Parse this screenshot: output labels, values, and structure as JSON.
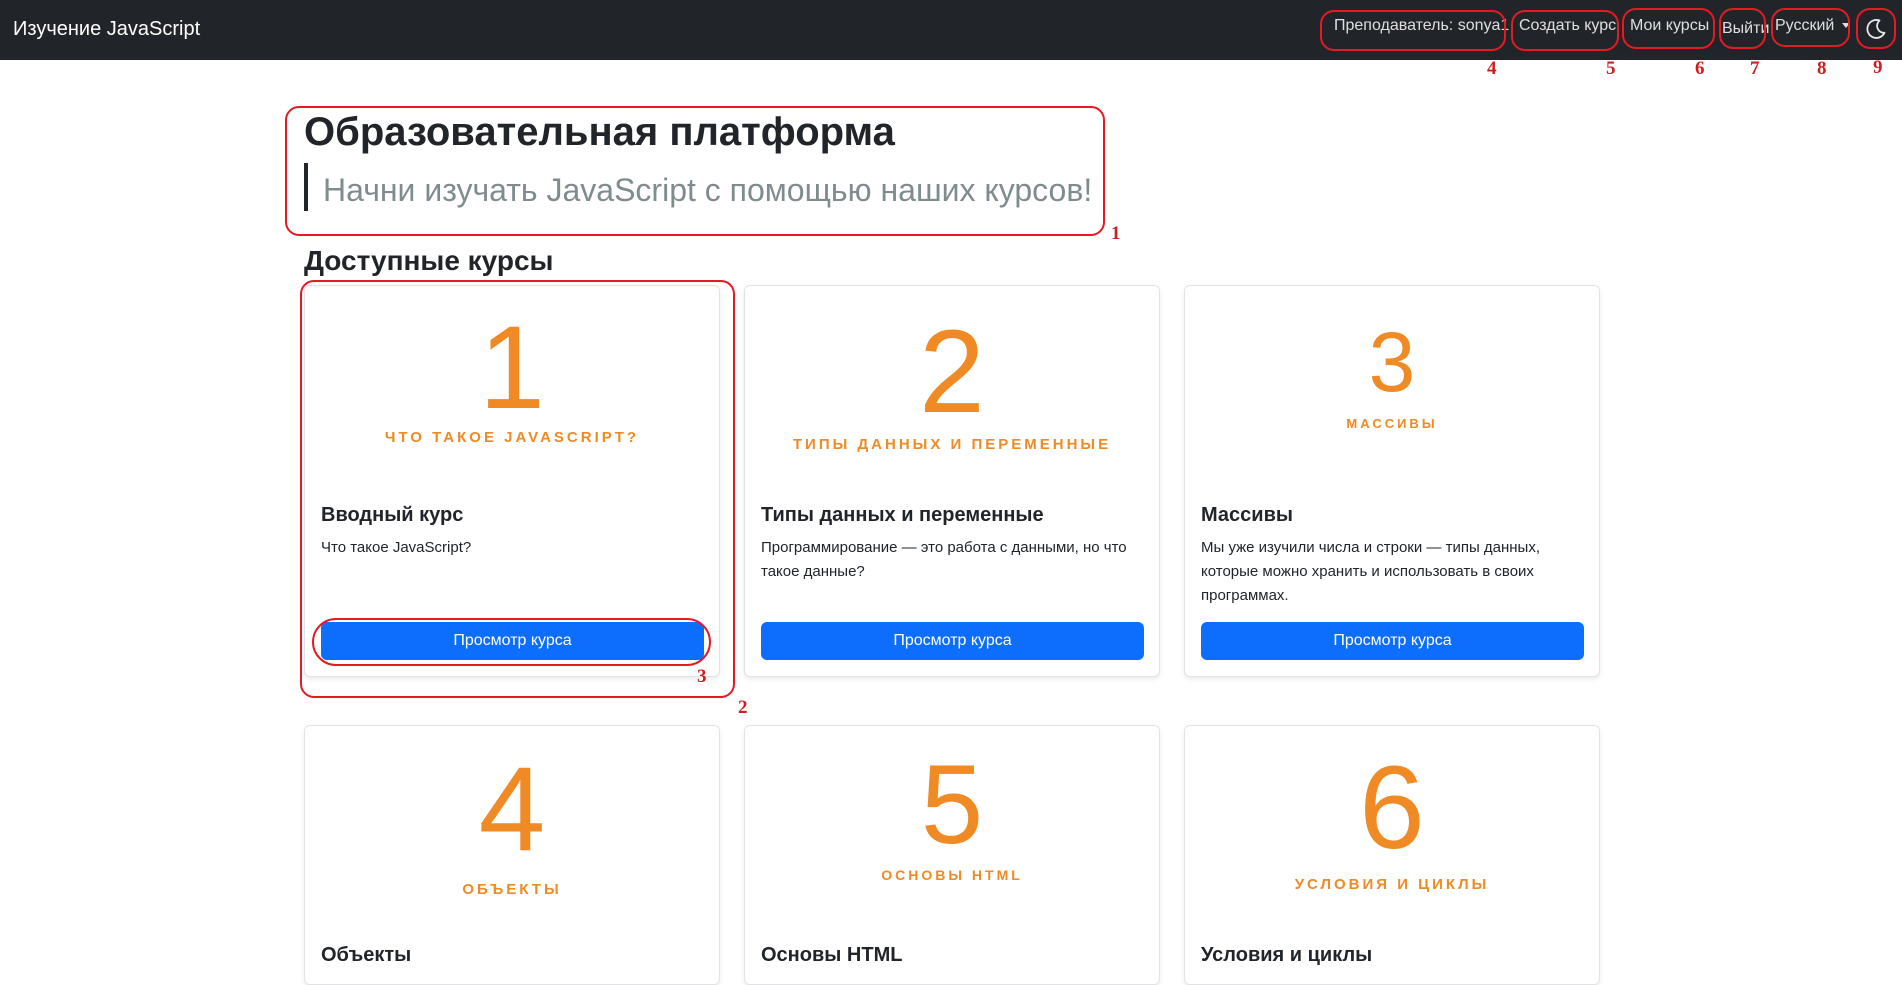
{
  "navbar": {
    "brand": "Изучение JavaScript",
    "teacher": "Преподаватель: sonya1",
    "create_course": "Создать курс",
    "my_courses": "Мои курсы",
    "logout": "Выйти",
    "language": "Русский",
    "theme_icon": "moon-icon"
  },
  "hero": {
    "title": "Образовательная платформа",
    "subtitle": "Начни изучать JavaScript с помощью наших курсов!"
  },
  "section_title": "Доступные курсы",
  "courses": [
    {
      "poster_number": "1",
      "poster_caption": "ЧТО ТАКОЕ JAVASCRIPT?",
      "title": "Вводный курс",
      "description": "Что такое JavaScript?",
      "button": "Просмотр курса"
    },
    {
      "poster_number": "2",
      "poster_caption": "ТИПЫ ДАННЫХ И ПЕРЕМЕННЫЕ",
      "title": "Типы данных и переменные",
      "description": "Программирование — это работа с данными, но что такое данные?",
      "button": "Просмотр курса"
    },
    {
      "poster_number": "3",
      "poster_caption": "МАССИВЫ",
      "title": "Массивы",
      "description": "Мы уже изучили числа и строки — типы данных, которые можно хранить и использовать в своих программах.",
      "button": "Просмотр курса"
    },
    {
      "poster_number": "4",
      "poster_caption": "ОБЪЕКТЫ",
      "title": "Объекты"
    },
    {
      "poster_number": "5",
      "poster_caption": "ОСНОВЫ HTML",
      "title": "Основы HTML"
    },
    {
      "poster_number": "6",
      "poster_caption": "УСЛОВИЯ И ЦИКЛЫ",
      "title": "Условия и циклы"
    }
  ],
  "annotations": [
    "1",
    "2",
    "3",
    "4",
    "5",
    "6",
    "7",
    "8",
    "9"
  ],
  "colors": {
    "navbar": "#212529",
    "accent": "#ef8a25",
    "button": "#0d6efd",
    "annotation": "#e31b23"
  }
}
